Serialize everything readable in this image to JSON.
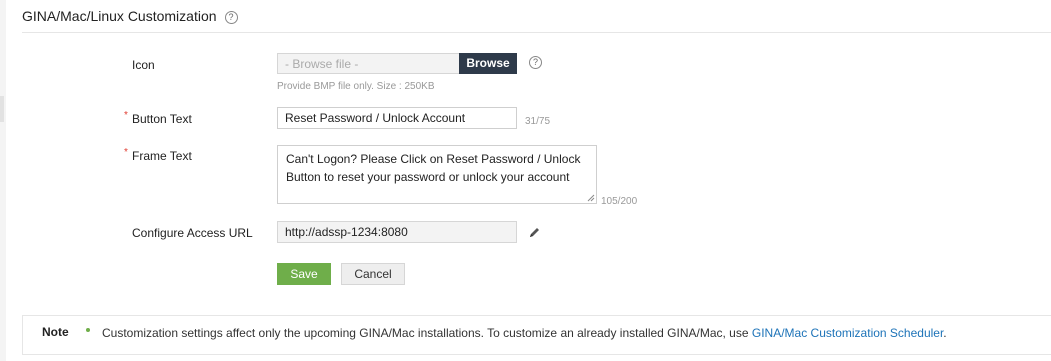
{
  "section": {
    "title": "GINA/Mac/Linux Customization",
    "help_glyph": "?"
  },
  "form": {
    "icon": {
      "label": "Icon",
      "file_placeholder": "- Browse file -",
      "browse_label": "Browse",
      "help_glyph": "?",
      "hint": "Provide BMP file only. Size : 250KB"
    },
    "button_text": {
      "required_mark": "*",
      "label": "Button Text",
      "value": "Reset Password / Unlock Account",
      "counter": "31/75"
    },
    "frame_text": {
      "required_mark": "*",
      "label": "Frame Text",
      "value": "Can't Logon? Please Click on Reset Password / Unlock Button to reset your password or unlock your account",
      "counter": "105/200"
    },
    "access_url": {
      "label": "Configure Access URL",
      "value": "http://adssp-1234:8080",
      "edit_icon": "pencil-icon"
    },
    "save_label": "Save",
    "cancel_label": "Cancel"
  },
  "note": {
    "title": "Note",
    "text": "Customization settings affect only the upcoming GINA/Mac installations. To customize an already installed GINA/Mac, use",
    "link_text": "GINA/Mac Customization Scheduler",
    "trailing": "."
  },
  "colors": {
    "accent_green": "#6fae4a",
    "browse_dark": "#2e3a4a",
    "required_red": "#e03c31",
    "link_blue": "#1d73b8"
  }
}
